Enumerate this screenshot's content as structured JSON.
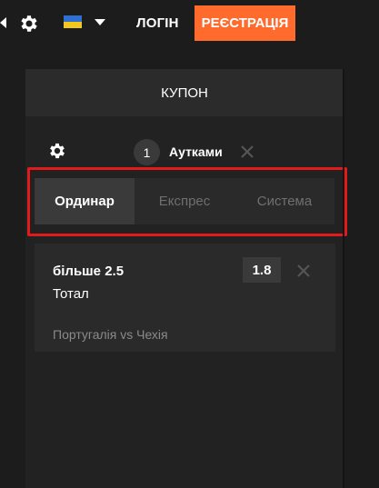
{
  "header": {
    "login_label": "ЛОГІН",
    "register_label": "РЕЄСТРАЦІЯ",
    "language_flag": "ukraine-flag",
    "accent_color": "#ff6a2d"
  },
  "coupon": {
    "title": "КУПОН",
    "selection_count": "1",
    "selection_name": "Аутками",
    "tabs": [
      {
        "label": "Ординар",
        "active": true
      },
      {
        "label": "Експрес",
        "active": false
      },
      {
        "label": "Система",
        "active": false
      }
    ],
    "highlight_color": "#e11b1b",
    "bet": {
      "selection": "більше 2.5",
      "market": "Тотал",
      "odds": "1.8",
      "match": "Португалія vs Чехія"
    }
  }
}
